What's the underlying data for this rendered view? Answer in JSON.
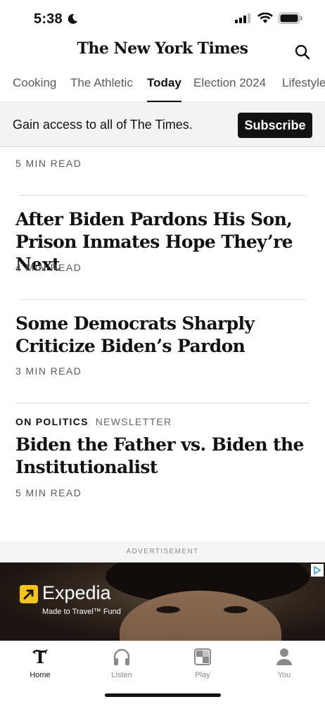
{
  "status": {
    "time": "5:38"
  },
  "masthead": {
    "logo": "The New York Times"
  },
  "tabs": [
    {
      "label": "Cooking"
    },
    {
      "label": "The Athletic"
    },
    {
      "label": "Today"
    },
    {
      "label": "Election 2024"
    },
    {
      "label": "Lifestyle"
    }
  ],
  "subscribe": {
    "text": "Gain access to all of The Times.",
    "button": "Subscribe"
  },
  "feed": {
    "top_partial_readtime": "5 MIN READ",
    "articles": [
      {
        "headline": "After Biden Pardons His Son, Prison Inmates Hope They’re Next",
        "readtime": "4 MIN READ"
      },
      {
        "headline": "Some Democrats Sharply Criticize Biden’s Pardon",
        "readtime": "3 MIN READ"
      },
      {
        "kicker_section": "ON POLITICS",
        "kicker_type": "NEWSLETTER",
        "headline": "Biden the Father vs. Biden the Institutionalist",
        "readtime": "5 MIN READ"
      }
    ]
  },
  "ad": {
    "label": "ADVERTISEMENT",
    "brand": "Expedia",
    "tagline": "Made to Travel™ Fund",
    "brand_color": "#F5C518"
  },
  "bottom_nav": [
    {
      "label": "Home",
      "icon": "nyt-t-icon",
      "active": true
    },
    {
      "label": "Listen",
      "icon": "headphones-icon",
      "active": false
    },
    {
      "label": "Play",
      "icon": "games-icon",
      "active": false
    },
    {
      "label": "You",
      "icon": "person-icon",
      "active": false
    }
  ]
}
